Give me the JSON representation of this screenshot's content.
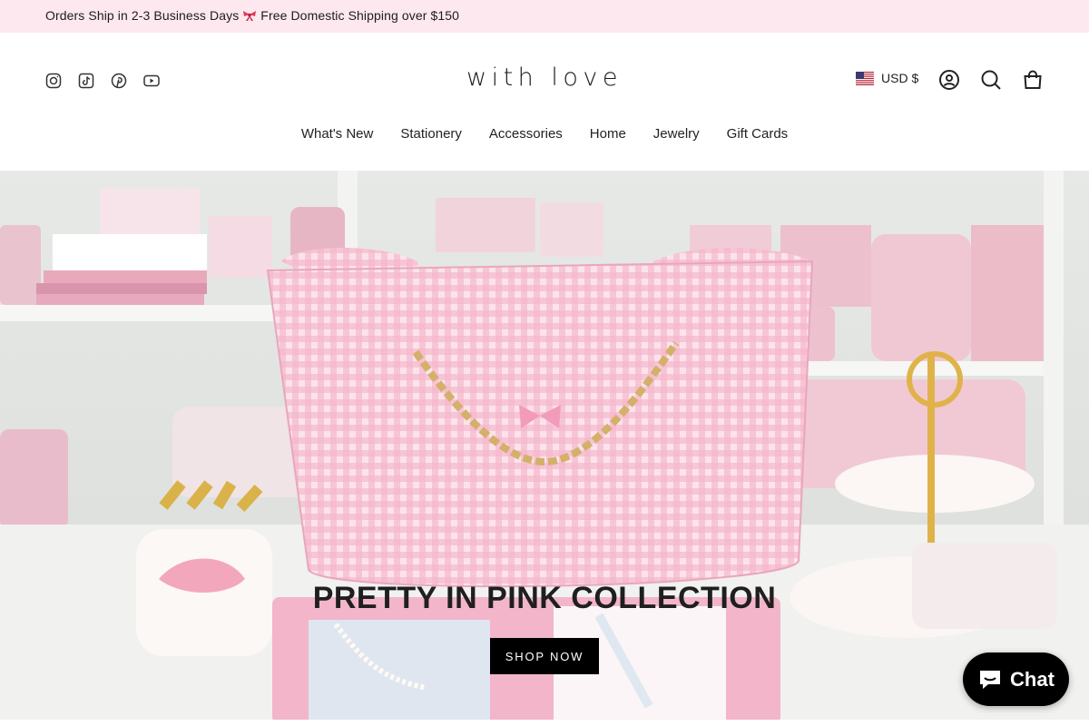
{
  "announcement": {
    "text_before": "Orders Ship in 2-3 Business Days",
    "text_after": "Free Domestic Shipping over $150",
    "emoji_icon": "ribbon-icon"
  },
  "header": {
    "logo": "with love",
    "socials": [
      "instagram-icon",
      "tiktok-icon",
      "pinterest-icon",
      "youtube-icon"
    ],
    "currency": "USD $",
    "icons": [
      "account-icon",
      "search-icon",
      "cart-icon"
    ]
  },
  "nav": {
    "items": [
      "What's New",
      "Stationery",
      "Accessories",
      "Home",
      "Jewelry",
      "Gift Cards"
    ]
  },
  "hero": {
    "title": "PRETTY IN PINK COLLECTION",
    "button": "SHOP NOW"
  },
  "chat": {
    "label": "Chat"
  },
  "colors": {
    "announcement_bg": "#fce8ee",
    "button_bg": "#000000",
    "pink": "#f4b8cc"
  }
}
